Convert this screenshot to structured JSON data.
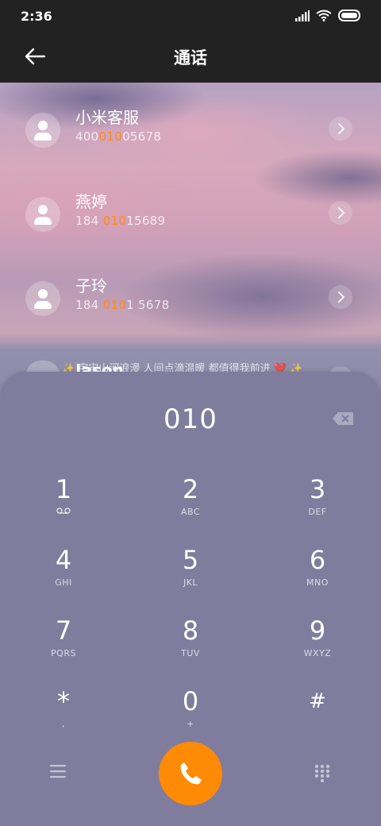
{
  "status_bar": {
    "time": "2:36",
    "icons": [
      "signal-icon",
      "wifi-icon",
      "battery-icon"
    ]
  },
  "header": {
    "back_icon": "back-arrow-icon",
    "title": "通话"
  },
  "contacts": [
    {
      "name": "小米客服",
      "number_parts": [
        "400",
        "010",
        "05678"
      ]
    },
    {
      "name": "燕婷",
      "number_parts": [
        "184 ",
        "010",
        "15689"
      ]
    },
    {
      "name": "子玲",
      "number_parts": [
        "184 ",
        "010",
        "1 5678"
      ]
    }
  ],
  "partial_contact": {
    "name": "Jason"
  },
  "announcement": "✨ 宇宙山河浪漫 人间点滴温暖 都值得我前进 ❤️ ✨",
  "dialpad": {
    "input": "010",
    "keys": [
      {
        "num": "1",
        "sub": "voicemail-icon"
      },
      {
        "num": "2",
        "sub": "ABC"
      },
      {
        "num": "3",
        "sub": "DEF"
      },
      {
        "num": "4",
        "sub": "GHI"
      },
      {
        "num": "5",
        "sub": "JKL"
      },
      {
        "num": "6",
        "sub": "MNO"
      },
      {
        "num": "7",
        "sub": "PQRS"
      },
      {
        "num": "8",
        "sub": "TUV"
      },
      {
        "num": "9",
        "sub": "WXYZ"
      },
      {
        "num": "*",
        "sub": ","
      },
      {
        "num": "0",
        "sub": "+"
      },
      {
        "num": "#",
        "sub": ""
      }
    ]
  },
  "colors": {
    "accent": "#ff8a05",
    "highlight": "#ff8a1f",
    "dialpad_bg": "#807c9d"
  }
}
